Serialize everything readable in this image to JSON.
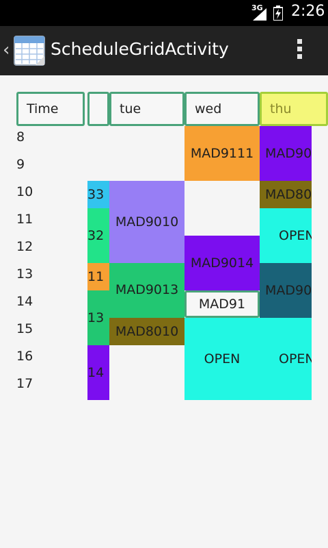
{
  "status": {
    "network": "3G",
    "time": "2:26"
  },
  "action_bar": {
    "title": "ScheduleGridActivity",
    "overflow_icon": "overflow-menu-icon"
  },
  "grid": {
    "headers": [
      "Time",
      "",
      "tue",
      "wed",
      "thu"
    ],
    "hours": [
      "8",
      "9",
      "10",
      "11",
      "12",
      "13",
      "14",
      "15",
      "16",
      "17"
    ],
    "cells": [
      {
        "name": "slot-col1-10",
        "text": "33",
        "bg": "#33c4ee"
      },
      {
        "name": "slot-col1-11",
        "text": "32",
        "bg": "#22e389"
      },
      {
        "name": "slot-col1-13",
        "text": "11",
        "bg": "#f6a033"
      },
      {
        "name": "slot-col1-14",
        "text": "13",
        "bg": "#22c772"
      },
      {
        "name": "slot-col1-16",
        "text": "14",
        "bg": "#7b0eef"
      },
      {
        "name": "slot-tue-10",
        "text": "MAD9010",
        "bg": "#977ef5"
      },
      {
        "name": "slot-tue-13",
        "text": "MAD9013",
        "bg": "#22c772"
      },
      {
        "name": "slot-tue-15",
        "text": "MAD8010",
        "bg": "#7e6c13"
      },
      {
        "name": "slot-wed-8",
        "text": "MAD9111",
        "bg": "#f7a033"
      },
      {
        "name": "slot-wed-12",
        "text": "MAD9014",
        "bg": "#7b0eef"
      },
      {
        "name": "slot-wed-14",
        "text": "MAD91",
        "bg": "#f7f7f7"
      },
      {
        "name": "slot-wed-15",
        "text": "OPEN",
        "bg": "#22f7e3"
      },
      {
        "name": "slot-thu-8",
        "text": "MAD90",
        "bg": "#7b0eef"
      },
      {
        "name": "slot-thu-10",
        "text": "MAD80",
        "bg": "#7e6c13"
      },
      {
        "name": "slot-thu-11",
        "text": "OPEN",
        "bg": "#22f7e3"
      },
      {
        "name": "slot-thu-13",
        "text": "MAD90",
        "bg": "#1a6278"
      },
      {
        "name": "slot-thu-15",
        "text": "OPEN",
        "bg": "#22f7e3"
      }
    ]
  }
}
